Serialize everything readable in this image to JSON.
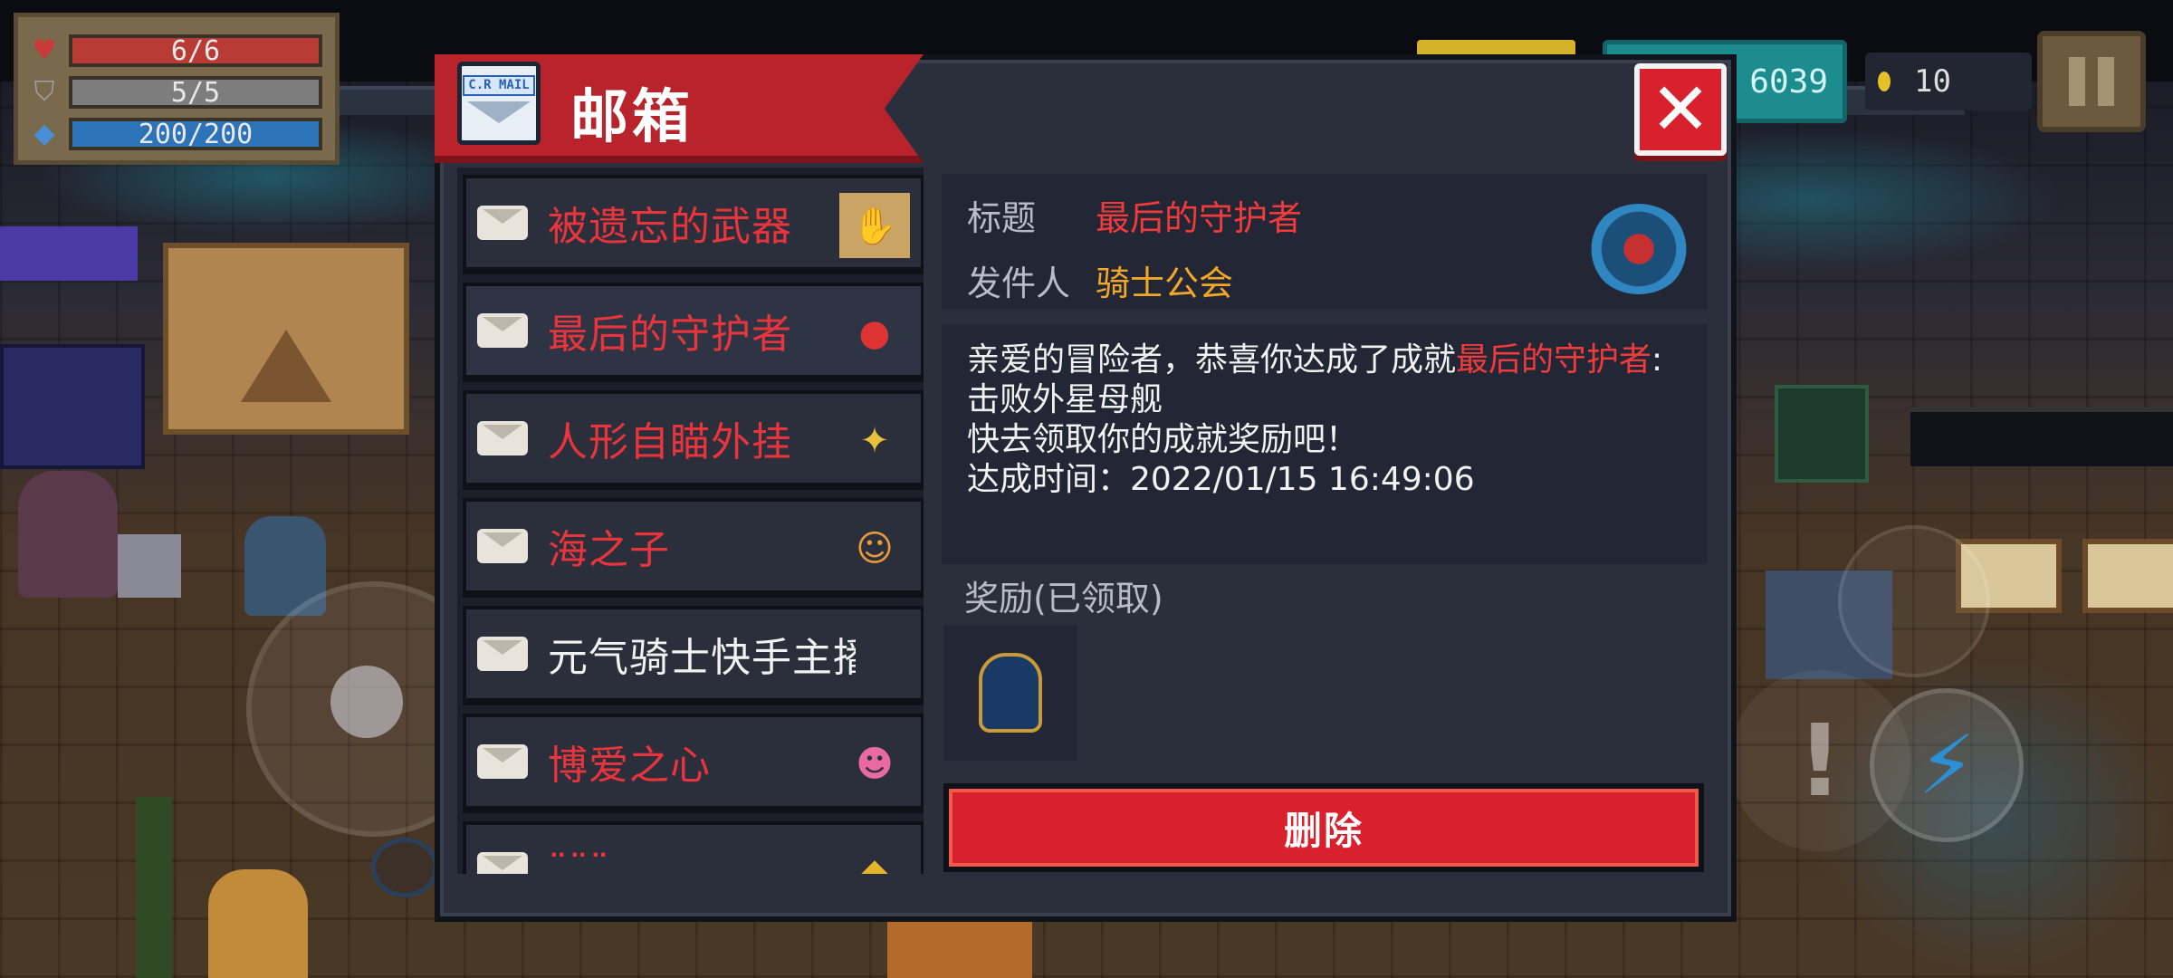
{
  "hud": {
    "hp": {
      "text": "6/6",
      "fraction": 1.0
    },
    "armor": {
      "text": "5/5",
      "fraction": 1.0
    },
    "energy": {
      "text": "200/200",
      "fraction": 1.0
    },
    "gems_text": "6039",
    "coins_text": "10",
    "icons": {
      "hp": "heart-icon",
      "armor": "shield-icon",
      "energy": "diamond-icon",
      "pause": "pause-icon",
      "skill": "lightning-icon"
    }
  },
  "dialog": {
    "title": "邮箱",
    "mail_icon_stamp": "C.R MAIL",
    "close_label": "✕"
  },
  "mails": [
    {
      "subject": "被遗忘的武器",
      "color": "red",
      "thumb": "weapon-scroll-icon"
    },
    {
      "subject": "最后的守护者",
      "color": "red",
      "thumb": "guardian-orb-icon",
      "selected": true
    },
    {
      "subject": "人形自瞄外挂",
      "color": "red",
      "thumb": "aimbot-robot-icon"
    },
    {
      "subject": "海之子",
      "color": "red",
      "thumb": "sea-child-icon"
    },
    {
      "subject": "元气骑士快手主播扌",
      "color": "white",
      "thumb": ""
    },
    {
      "subject": "博爱之心",
      "color": "red",
      "thumb": "pets-group-icon"
    },
    {
      "subject": "¨¨¨",
      "color": "red",
      "thumb": "gold-icon"
    }
  ],
  "detail": {
    "title_label": "标题",
    "title_value": "最后的守护者",
    "sender_label": "发件人",
    "sender_value": "骑士公会",
    "body_prefix": "亲爱的冒险者，恭喜你达成了成就",
    "body_highlight": "最后的守护者",
    "body_suffix": ":击败外星母舰",
    "body_line2": "快去领取你的成就奖励吧！",
    "body_line3": "达成时间：2022/01/15 16:49:06",
    "reward_label": "奖励(已领取)",
    "delete_label": "删除"
  },
  "colors": {
    "accent_red": "#d9202d",
    "subject_red": "#e8343c",
    "sender_orange": "#f0a72a"
  }
}
